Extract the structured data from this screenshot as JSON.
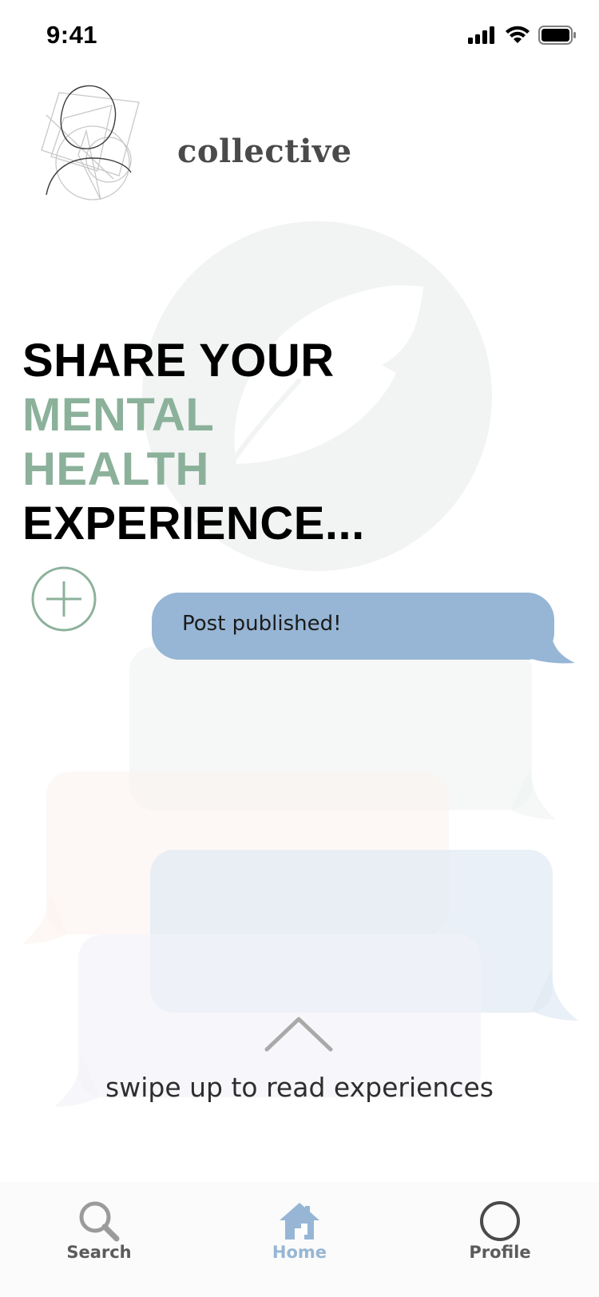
{
  "status_bar": {
    "time": "9:41",
    "icons": [
      "cellular-signal-icon",
      "wifi-icon",
      "battery-icon"
    ]
  },
  "brand": {
    "name": "collective",
    "logo_icon": "abstract-head-logo-icon"
  },
  "headline": {
    "line1": "SHARE YOUR",
    "line2": "MENTAL",
    "line3": "HEALTH",
    "line4": "EXPERIENCE..."
  },
  "add_post": {
    "icon": "plus-circle-icon"
  },
  "toast": {
    "text": "Post published!"
  },
  "swipe": {
    "icon": "chevron-up-icon",
    "text": "swipe up to read experiences"
  },
  "tab_bar": {
    "items": [
      {
        "label": "Search",
        "icon": "search-icon",
        "active": false
      },
      {
        "label": "Home",
        "icon": "home-icon",
        "active": true
      },
      {
        "label": "Profile",
        "icon": "profile-circle-icon",
        "active": false
      }
    ]
  },
  "colors": {
    "accent_green": "#8cb19b",
    "accent_blue": "#97b6d5",
    "tab_bar_bg": "#fafbfa",
    "text_dark": "#000000"
  }
}
